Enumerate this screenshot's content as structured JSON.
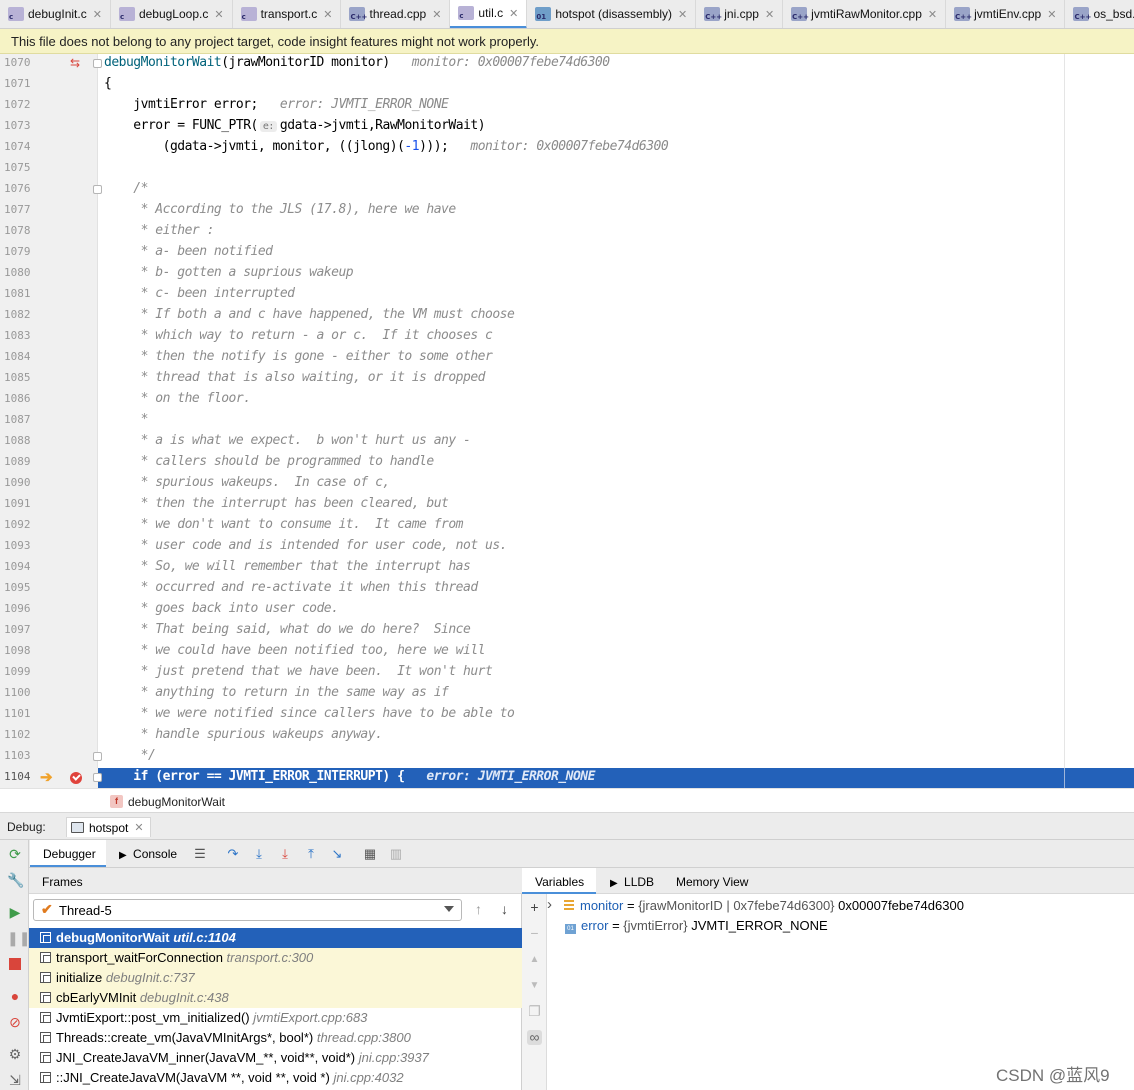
{
  "tabs": [
    {
      "label": "debugInit.c",
      "icon": "c-file-icon",
      "closable": true,
      "active": false
    },
    {
      "label": "debugLoop.c",
      "icon": "c-file-icon",
      "closable": true,
      "active": false
    },
    {
      "label": "transport.c",
      "icon": "c-file-icon",
      "closable": true,
      "active": false
    },
    {
      "label": "thread.cpp",
      "icon": "cpp-file-icon",
      "closable": true,
      "active": false
    },
    {
      "label": "util.c",
      "icon": "c-file-icon",
      "closable": true,
      "active": true
    },
    {
      "label": "hotspot (disassembly)",
      "icon": "disassembly-icon",
      "closable": true,
      "active": false
    },
    {
      "label": "jni.cpp",
      "icon": "cpp-file-icon",
      "closable": true,
      "active": false
    },
    {
      "label": "jvmtiRawMonitor.cpp",
      "icon": "cpp-file-icon",
      "closable": true,
      "active": false
    },
    {
      "label": "jvmtiEnv.cpp",
      "icon": "cpp-file-icon",
      "closable": true,
      "active": false
    },
    {
      "label": "os_bsd.cpp",
      "icon": "cpp-file-icon",
      "closable": false,
      "active": false
    }
  ],
  "banner": {
    "text": "This file does not belong to any project target, code insight features might not work properly."
  },
  "editor": {
    "lines": [
      {
        "n": "1070",
        "text": "debugMonitorWait(jrawMonitorID monitor)",
        "hint": "monitor: 0x00007febe74d6300"
      },
      {
        "n": "1071",
        "text": "{"
      },
      {
        "n": "1072",
        "text": "    jvmtiError error;",
        "hint": "error: JVMTI_ERROR_NONE"
      },
      {
        "n": "1073",
        "text": "    error = FUNC_PTR(",
        "pill": "e:",
        "text2": "gdata->jvmti,RawMonitorWait)"
      },
      {
        "n": "1074",
        "text": "        (gdata->jvmti, monitor, ((jlong)(",
        "num": "-1",
        "text2": ")));",
        "hint": "monitor: 0x00007febe74d6300"
      },
      {
        "n": "1075",
        "text": ""
      },
      {
        "n": "1076",
        "text": "    /*"
      },
      {
        "n": "1077",
        "text": "     * According to the JLS (17.8), here we have"
      },
      {
        "n": "1078",
        "text": "     * either :"
      },
      {
        "n": "1079",
        "text": "     * a- been notified"
      },
      {
        "n": "1080",
        "text": "     * b- gotten a suprious wakeup"
      },
      {
        "n": "1081",
        "text": "     * c- been interrupted"
      },
      {
        "n": "1082",
        "text": "     * If both a and c have happened, the VM must choose"
      },
      {
        "n": "1083",
        "text": "     * which way to return - a or c.  If it chooses c"
      },
      {
        "n": "1084",
        "text": "     * then the notify is gone - either to some other"
      },
      {
        "n": "1085",
        "text": "     * thread that is also waiting, or it is dropped"
      },
      {
        "n": "1086",
        "text": "     * on the floor."
      },
      {
        "n": "1087",
        "text": "     *"
      },
      {
        "n": "1088",
        "text": "     * a is what we expect.  b won't hurt us any -"
      },
      {
        "n": "1089",
        "text": "     * callers should be programmed to handle"
      },
      {
        "n": "1090",
        "text": "     * spurious wakeups.  In case of c,"
      },
      {
        "n": "1091",
        "text": "     * then the interrupt has been cleared, but"
      },
      {
        "n": "1092",
        "text": "     * we don't want to consume it.  It came from"
      },
      {
        "n": "1093",
        "text": "     * user code and is intended for user code, not us."
      },
      {
        "n": "1094",
        "text": "     * So, we will remember that the interrupt has"
      },
      {
        "n": "1095",
        "text": "     * occurred and re-activate it when this thread"
      },
      {
        "n": "1096",
        "text": "     * goes back into user code."
      },
      {
        "n": "1097",
        "text": "     * That being said, what do we do here?  Since"
      },
      {
        "n": "1098",
        "text": "     * we could have been notified too, here we will"
      },
      {
        "n": "1099",
        "text": "     * just pretend that we have been.  It won't hurt"
      },
      {
        "n": "1100",
        "text": "     * anything to return in the same way as if"
      },
      {
        "n": "1101",
        "text": "     * we were notified since callers have to be able to"
      },
      {
        "n": "1102",
        "text": "     * handle spurious wakeups anyway."
      },
      {
        "n": "1103",
        "text": "     */"
      },
      {
        "n": "1104",
        "text": "    if (error == JVMTI_ERROR_INTERRUPT) {",
        "hint": "error: JVMTI_ERROR_NONE"
      }
    ]
  },
  "breadcrumb": {
    "badge": "f",
    "label": "debugMonitorWait"
  },
  "debug": {
    "label": "Debug:",
    "session": "hotspot",
    "tabs": {
      "debugger": "Debugger",
      "console": "Console"
    },
    "frames_title": "Frames",
    "thread": "Thread-5",
    "frames": [
      {
        "name": "debugMonitorWait",
        "loc": "util.c:1104"
      },
      {
        "name": "transport_waitForConnection",
        "loc": "transport.c:300"
      },
      {
        "name": "initialize",
        "loc": "debugInit.c:737"
      },
      {
        "name": "cbEarlyVMInit",
        "loc": "debugInit.c:438"
      },
      {
        "name": "JvmtiExport::post_vm_initialized()",
        "loc": "jvmtiExport.cpp:683"
      },
      {
        "name": "Threads::create_vm(JavaVMInitArgs*, bool*)",
        "loc": "thread.cpp:3800"
      },
      {
        "name": "JNI_CreateJavaVM_inner(JavaVM_**, void**, void*)",
        "loc": "jni.cpp:3937"
      },
      {
        "name": "::JNI_CreateJavaVM(JavaVM **, void **, void *)",
        "loc": "jni.cpp:4032"
      }
    ],
    "vars_tabs": {
      "variables": "Variables",
      "lldb": "LLDB",
      "memory": "Memory View"
    },
    "variables": [
      {
        "name": "monitor",
        "eq": " = ",
        "type": "{jrawMonitorID | 0x7febe74d6300}",
        "value": " 0x00007febe74d6300"
      },
      {
        "name": "error",
        "eq": " = ",
        "type": "{jvmtiError}",
        "value": " JVMTI_ERROR_NONE"
      }
    ]
  },
  "watermark": "CSDN @蓝风9",
  "colors": {
    "selection": "#2361b9",
    "banner": "#f6f3c5",
    "frame_highlight": "#fbf7d7",
    "accent": "#4a8fd9"
  }
}
